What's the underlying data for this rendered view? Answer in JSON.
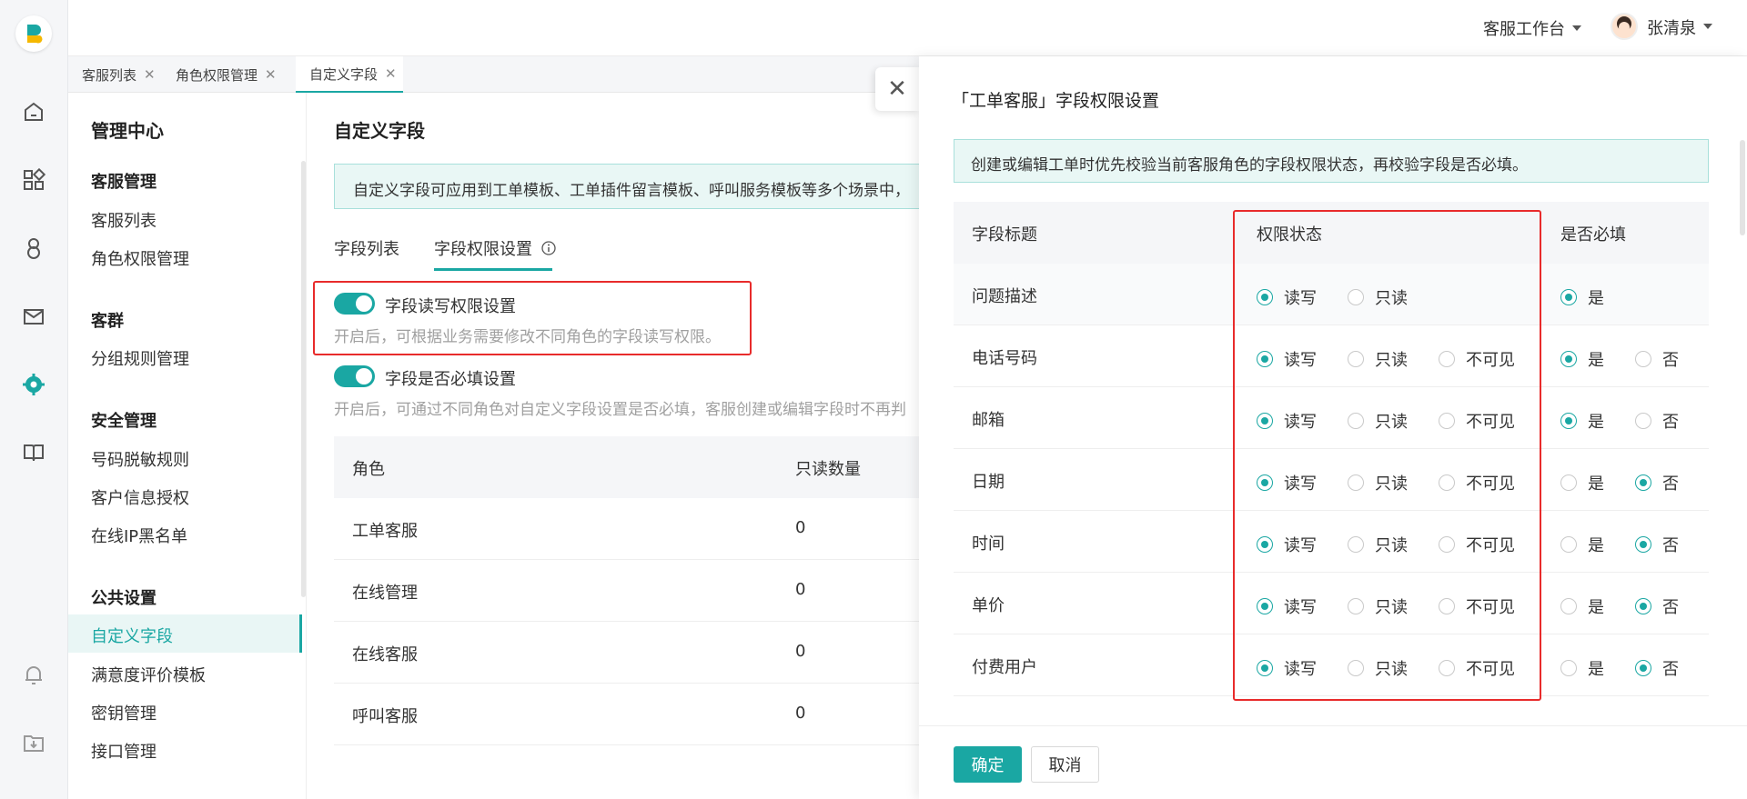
{
  "header": {
    "workspace": "客服工作台",
    "user_name": "张清泉"
  },
  "tabs": [
    {
      "label": "客服列表"
    },
    {
      "label": "角色权限管理"
    },
    {
      "label": "自定义字段"
    }
  ],
  "sidebar": {
    "title": "管理中心",
    "groups": [
      {
        "label": "客服管理",
        "items": [
          "客服列表",
          "角色权限管理"
        ]
      },
      {
        "label": "客群",
        "items": [
          "分组规则管理"
        ]
      },
      {
        "label": "安全管理",
        "items": [
          "号码脱敏规则",
          "客户信息授权",
          "在线IP黑名单"
        ]
      },
      {
        "label": "公共设置",
        "items": [
          "自定义字段",
          "满意度评价模板",
          "密钥管理",
          "接口管理"
        ]
      }
    ]
  },
  "main": {
    "title": "自定义字段",
    "info": "自定义字段可应用到工单模板、工单插件留言模板、呼叫服务模板等多个场景中，",
    "tabs": [
      "字段列表",
      "字段权限设置"
    ],
    "setting1": {
      "label": "字段读写权限设置",
      "desc": "开启后，可根据业务需要修改不同角色的字段读写权限。"
    },
    "setting2": {
      "label": "字段是否必填设置",
      "desc": "开启后，可通过不同角色对自定义字段设置是否必填，客服创建或编辑字段时不再判"
    },
    "table": {
      "headers": [
        "角色",
        "只读数量"
      ],
      "rows": [
        [
          "工单客服",
          "0"
        ],
        [
          "在线管理",
          "0"
        ],
        [
          "在线客服",
          "0"
        ],
        [
          "呼叫客服",
          "0"
        ]
      ]
    }
  },
  "drawer": {
    "title": "「工单客服」字段权限设置",
    "info": "创建或编辑工单时优先校验当前客服角色的字段权限状态，再校验字段是否必填。",
    "headers": [
      "字段标题",
      "权限状态",
      "是否必填"
    ],
    "perm_options": [
      "读写",
      "只读",
      "不可见"
    ],
    "req_options": [
      "是",
      "否"
    ],
    "rows": [
      {
        "field": "问题描述",
        "perm": "读写",
        "show_invisible": false,
        "required": "是",
        "show_no": false
      },
      {
        "field": "电话号码",
        "perm": "读写",
        "show_invisible": true,
        "required": "是",
        "show_no": true
      },
      {
        "field": "邮箱",
        "perm": "读写",
        "show_invisible": true,
        "required": "是",
        "show_no": true
      },
      {
        "field": "日期",
        "perm": "读写",
        "show_invisible": true,
        "required": "否",
        "show_no": true
      },
      {
        "field": "时间",
        "perm": "读写",
        "show_invisible": true,
        "required": "否",
        "show_no": true
      },
      {
        "field": "单价",
        "perm": "读写",
        "show_invisible": true,
        "required": "否",
        "show_no": true
      },
      {
        "field": "付费用户",
        "perm": "读写",
        "show_invisible": true,
        "required": "否",
        "show_no": true
      }
    ],
    "confirm_label": "确定",
    "cancel_label": "取消"
  },
  "colors": {
    "accent": "#1aa7a3",
    "highlight": "#e82b2b"
  }
}
